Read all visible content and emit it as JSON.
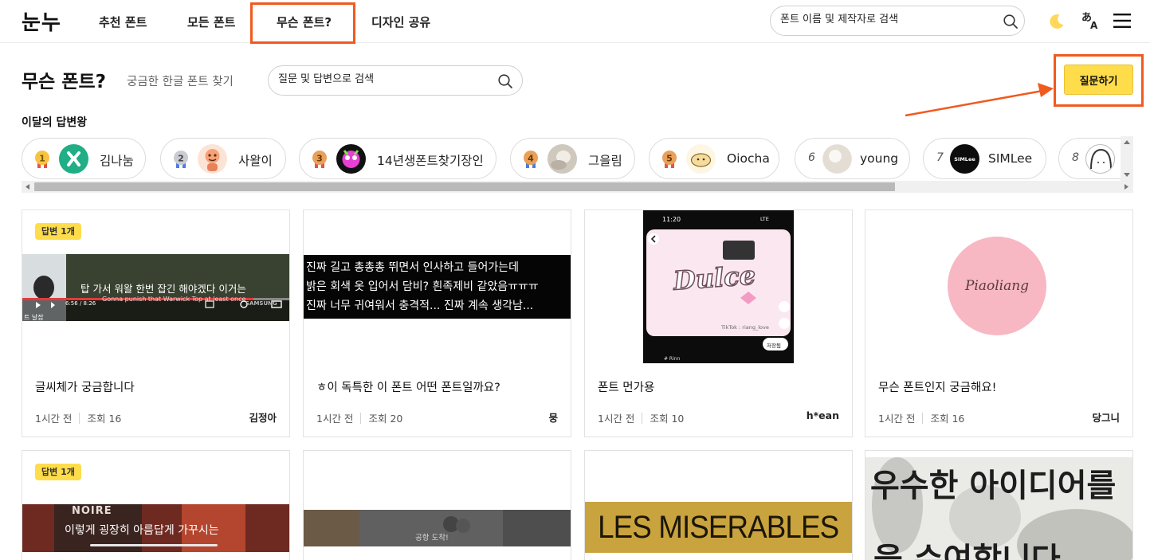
{
  "header": {
    "logo": "눈누",
    "nav": [
      {
        "label": "추천 폰트"
      },
      {
        "label": "모든 폰트"
      },
      {
        "label": "무슨 폰트?"
      },
      {
        "label": "디자인 공유"
      }
    ],
    "search_placeholder": "폰트 이름 및 제작자로 검색"
  },
  "page": {
    "title": "무슨 폰트?",
    "subtitle": "궁금한 한글 폰트 찾기",
    "search_placeholder": "질문 및 답변으로 검색",
    "ask_button": "질문하기"
  },
  "ranking": {
    "heading": "이달의 답변왕",
    "items": [
      {
        "rank": "1",
        "name": "김나눔"
      },
      {
        "rank": "2",
        "name": "사왈이"
      },
      {
        "rank": "3",
        "name": "14년생폰트찾기장인"
      },
      {
        "rank": "4",
        "name": "그을림"
      },
      {
        "rank": "5",
        "name": "Oiocha"
      },
      {
        "rank": "6",
        "name": "young"
      },
      {
        "rank": "7",
        "name": "SIMLee",
        "avatar_text": "SIMLee"
      },
      {
        "rank": "8",
        "name": ""
      }
    ]
  },
  "cards": [
    {
      "badge": "답변 1개",
      "title": "글씨체가 궁금합니다",
      "time": "1시간 전",
      "views_label": "조회",
      "views": "16",
      "author": "김정아",
      "thumb_caption": "탑 가서 워왈 한번 잡긴 해야겠다 이거는",
      "thumb_sub": "Gonna punish that Warwick Top at least once",
      "thumb_brand": "SAMSUNG",
      "thumb_time": "6:56 / 8:26",
      "thumb_corner": "트 날잡"
    },
    {
      "badge": "",
      "title": "ㅎ이 독특한 이 폰트 어떤 폰트일까요?",
      "time": "1시간 전",
      "views_label": "조회",
      "views": "20",
      "author": "뭉",
      "thumb_lines": [
        "진짜 길고 총총총 뛰면서 인사하고 들어가는데",
        "밝은 회색 옷 입어서 담비? 흰족제비 같았음ㅠㅠㅠ",
        "진짜 너무 귀여워서 충격적... 진짜 계속 생각남..."
      ]
    },
    {
      "badge": "",
      "title": "폰트 먼가용",
      "time": "1시간 전",
      "views_label": "조회",
      "views": "10",
      "author": "h*ean",
      "thumb_status_time": "11:20",
      "thumb_status_right": "LTE",
      "thumb_logo": "Dulce",
      "thumb_tag": "TikTok : riang_love",
      "thumb_save": "저장됨",
      "thumb_user": "# Rinn"
    },
    {
      "badge": "",
      "title": "무슨 폰트인지 궁금해요!",
      "time": "1시간 전",
      "views_label": "조회",
      "views": "16",
      "author": "당그니",
      "thumb_logo": "Piaoliang"
    },
    {
      "badge": "답변 1개",
      "thumb_caption": "이렇게 굉장히 아름답게 가꾸시는",
      "thumb_sign": "NOIRE"
    },
    {
      "badge": "",
      "thumb_caption": "공항 도착!"
    },
    {
      "badge": "",
      "thumb_caption": "LES MISERABLES"
    },
    {
      "badge": "",
      "thumb_lines": [
        "우수한 아이디어를",
        "을 수여합니다"
      ]
    }
  ],
  "colors": {
    "accent_yellow": "#ffdc4a",
    "highlight_orange": "#f05a1f",
    "moon_yellow": "#ffd75a"
  }
}
